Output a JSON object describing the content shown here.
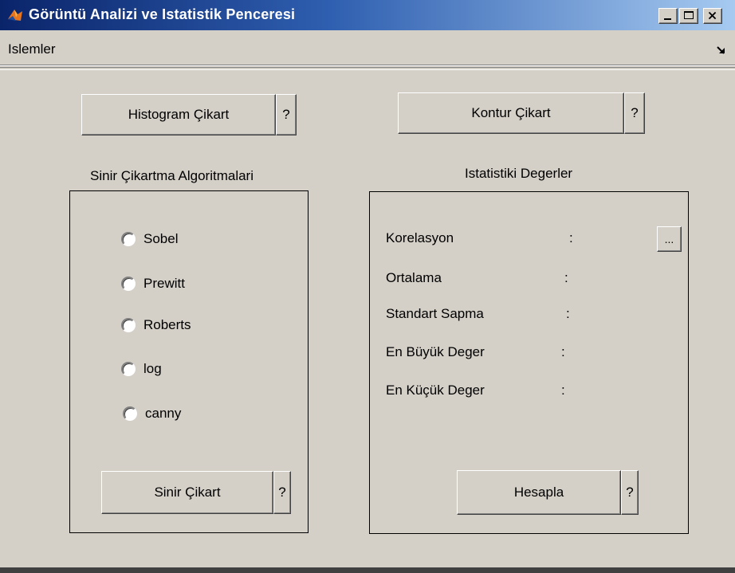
{
  "window": {
    "title": "Görüntü Analizi ve Istatistik Penceresi",
    "controls": {
      "minimize": "_",
      "maximize": "□",
      "close": "x"
    }
  },
  "menu": {
    "items": [
      {
        "label": "Islemler"
      }
    ],
    "arrow_icon": "corner-arrow-icon"
  },
  "top_buttons": {
    "histogram": {
      "label": "Histogram Çikart",
      "help": "?"
    },
    "kontur": {
      "label": "Kontur Çikart",
      "help": "?"
    }
  },
  "edge_panel": {
    "title": "Sinir Çikartma Algoritmalari",
    "options": [
      {
        "label": "Sobel"
      },
      {
        "label": "Prewitt"
      },
      {
        "label": "Roberts"
      },
      {
        "label": "log"
      },
      {
        "label": "canny"
      }
    ],
    "run_button": {
      "label": "Sinir Çikart",
      "help": "?"
    }
  },
  "stats_panel": {
    "title": "Istatistiki Degerler",
    "rows": [
      {
        "label": "Korelasyon",
        "sep": ":"
      },
      {
        "label": "Ortalama",
        "sep": ":"
      },
      {
        "label": "Standart Sapma",
        "sep": ":"
      },
      {
        "label": "En Büyük Deger",
        "sep": ":"
      },
      {
        "label": "En Küçük Deger",
        "sep": ":"
      }
    ],
    "more_button": "...",
    "compute_button": {
      "label": "Hesapla",
      "help": "?"
    }
  },
  "colors": {
    "face": "#d4d0c8",
    "title_start": "#0a246a",
    "title_end": "#a6caf0"
  }
}
